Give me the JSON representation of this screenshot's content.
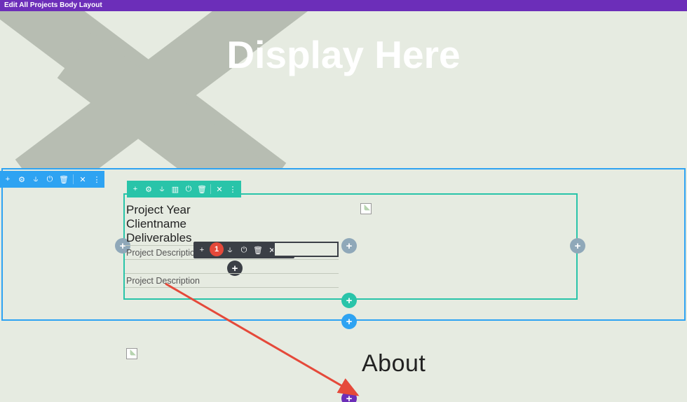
{
  "topbar": {
    "title": "Edit All Projects Body Layout"
  },
  "hero": {
    "title": "Display Here"
  },
  "row_content": {
    "line1": "Project Year",
    "line2": "Clientname",
    "line3": "Deliverables",
    "desc1": "Project Description",
    "desc2": "Project Description"
  },
  "lower": {
    "heading": "About"
  },
  "badge": {
    "num": "1"
  },
  "icons": {
    "plus": "+",
    "gear": "⚙",
    "dup": "⫝",
    "power": "⏻",
    "trash": "🗑",
    "close": "✕",
    "more": "⋮",
    "cols": "▥"
  }
}
